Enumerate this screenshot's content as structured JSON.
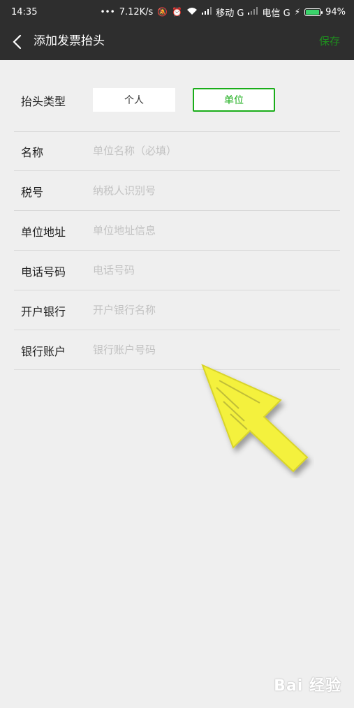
{
  "status_bar": {
    "time": "14:35",
    "speed": "7.12K/s",
    "carrier1": "移动 G",
    "carrier2": "电信 G",
    "battery": "94%"
  },
  "nav": {
    "title": "添加发票抬头",
    "save_label": "保存"
  },
  "header_type": {
    "label": "抬头类型",
    "options": [
      "个人",
      "单位"
    ],
    "selected": "单位"
  },
  "fields": [
    {
      "label": "名称",
      "placeholder": "单位名称（必填）",
      "value": ""
    },
    {
      "label": "税号",
      "placeholder": "纳税人识别号",
      "value": ""
    },
    {
      "label": "单位地址",
      "placeholder": "单位地址信息",
      "value": ""
    },
    {
      "label": "电话号码",
      "placeholder": "电话号码",
      "value": ""
    },
    {
      "label": "开户银行",
      "placeholder": "开户银行名称",
      "value": ""
    },
    {
      "label": "银行账户",
      "placeholder": "银行账户号码",
      "value": ""
    }
  ],
  "watermark": "Bai 经验",
  "colors": {
    "accent": "#1aad19",
    "nav_bg": "#2e2e2e",
    "page_bg": "#efefef",
    "annotation_arrow": "#f4f13c"
  },
  "icons": [
    "back-arrow-icon",
    "wifi-icon",
    "alarm-icon",
    "battery-icon"
  ]
}
